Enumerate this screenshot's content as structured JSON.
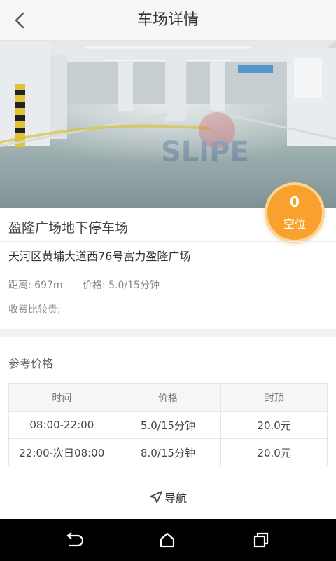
{
  "header": {
    "title": "车场详情",
    "back_icon": "chevron-left-icon"
  },
  "hero": {
    "photo": "underground-parking-garage-photo"
  },
  "badge": {
    "count": "0",
    "label": "空位",
    "color": "#f8a12f"
  },
  "lot": {
    "name": "盈隆广场地下停车场",
    "address": "天河区黄埔大道西76号富力盈隆广场",
    "distance": "距离: 697m",
    "price": "价格: 5.0/15分钟",
    "note": "收费比较贵;"
  },
  "reference_price": {
    "title": "参考价格",
    "columns": [
      "时间",
      "价格",
      "封顶"
    ],
    "rows": [
      [
        "08:00-22:00",
        "5.0/15分钟",
        "20.0元"
      ],
      [
        "22:00-次日08:00",
        "8.0/15分钟",
        "20.0元"
      ]
    ]
  },
  "navigate": {
    "label": "导航",
    "icon": "navigation-arrow-icon"
  },
  "system_bar": {
    "back_icon": "system-back-icon",
    "home_icon": "system-home-icon",
    "recents_icon": "system-recents-icon"
  }
}
